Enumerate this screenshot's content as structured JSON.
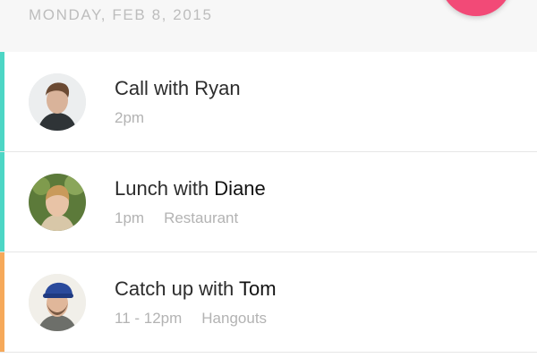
{
  "header": {
    "date": "MONDAY, FEB 8, 2015"
  },
  "colors": {
    "accent_teal": "#4dd6c5",
    "accent_orange": "#f6a95a",
    "fab_pink": "#f24a77"
  },
  "events": [
    {
      "title_prefix": "Call with Ryan",
      "title_name": "",
      "time": "2pm",
      "location": "",
      "accent": "teal",
      "avatar": "avatar-ryan"
    },
    {
      "title_prefix": "Lunch with ",
      "title_name": "Diane",
      "time": "1pm",
      "location": "Restaurant",
      "accent": "teal",
      "avatar": "avatar-diane"
    },
    {
      "title_prefix": "Catch up with ",
      "title_name": "Tom",
      "time": "11 - 12pm",
      "location": "Hangouts",
      "accent": "orange",
      "avatar": "avatar-tom"
    }
  ]
}
